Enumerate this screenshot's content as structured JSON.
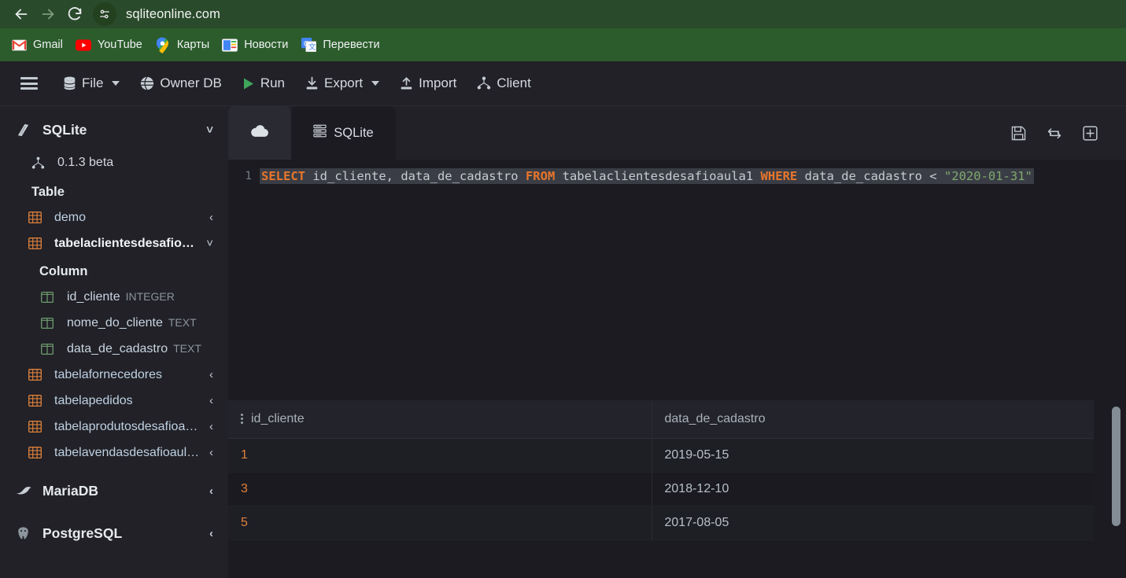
{
  "browser": {
    "back_icon": "back-arrow-icon",
    "forward_icon": "forward-arrow-icon",
    "reload_icon": "reload-icon",
    "site_info_icon": "site-settings-icon",
    "url": "sqliteonline.com",
    "toolbar_bg": "#2A4B2B",
    "bookmarks_bg": "#2C5C2C",
    "bookmarks": [
      {
        "label": "Gmail",
        "icon": "gmail-icon"
      },
      {
        "label": "YouTube",
        "icon": "youtube-icon"
      },
      {
        "label": "Карты",
        "icon": "google-maps-icon"
      },
      {
        "label": "Новости",
        "icon": "google-news-icon"
      },
      {
        "label": "Перевести",
        "icon": "google-translate-icon"
      }
    ]
  },
  "app_toolbar": {
    "menu_icon": "hamburger-menu-icon",
    "items": [
      {
        "label": "File",
        "icon": "database-stack-icon",
        "has_caret": true
      },
      {
        "label": "Owner DB",
        "icon": "globe-icon",
        "has_caret": false
      },
      {
        "label": "Run",
        "icon": "play-icon",
        "has_caret": false
      },
      {
        "label": "Export",
        "icon": "download-icon",
        "has_caret": true
      },
      {
        "label": "Import",
        "icon": "upload-icon",
        "has_caret": false
      },
      {
        "label": "Client",
        "icon": "network-nodes-icon",
        "has_caret": false
      }
    ],
    "run_color": "#3FA65B"
  },
  "sidebar": {
    "engines": [
      {
        "label": "SQLite",
        "icon": "sqlite-icon",
        "chevron": "chevron-down",
        "expanded": true
      },
      {
        "label": "MariaDB",
        "icon": "mariadb-icon",
        "chevron": "chevron-left",
        "expanded": false
      },
      {
        "label": "PostgreSQL",
        "icon": "postgresql-icon",
        "chevron": "chevron-left",
        "expanded": false
      }
    ],
    "version": {
      "label": "0.1.3 beta",
      "icon": "network-nodes-icon"
    },
    "table_section_label": "Table",
    "column_section_label": "Column",
    "tables": [
      {
        "label": "demo",
        "icon": "table-icon",
        "chevron": "chevron-left",
        "selected": false
      },
      {
        "label": "tabelaclientesdesafio…",
        "icon": "table-icon",
        "chevron": "chevron-down",
        "selected": true
      },
      {
        "label": "tabelafornecedores",
        "icon": "table-icon",
        "chevron": "chevron-left",
        "selected": false
      },
      {
        "label": "tabelapedidos",
        "icon": "table-icon",
        "chevron": "chevron-left",
        "selected": false
      },
      {
        "label": "tabelaprodutosdesafioa…",
        "icon": "table-icon",
        "chevron": "chevron-left",
        "selected": false
      },
      {
        "label": "tabelavendasdesafioaul…",
        "icon": "table-icon",
        "chevron": "chevron-left",
        "selected": false
      }
    ],
    "columns": [
      {
        "name": "id_cliente",
        "type": "INTEGER",
        "icon": "column-icon"
      },
      {
        "name": "nome_do_cliente",
        "type": "TEXT",
        "icon": "column-icon"
      },
      {
        "name": "data_de_cadastro",
        "type": "TEXT",
        "icon": "column-icon"
      }
    ],
    "table_icon_color": "#E0823C",
    "column_icon_color": "#6E9B6E"
  },
  "tabs": {
    "cloud_tab": {
      "label": "",
      "icon": "cloud-icon",
      "active": false
    },
    "sqlite_tab": {
      "label": "SQLite",
      "icon": "database-server-icon",
      "active": true
    }
  },
  "editor_actions": [
    {
      "icon": "save-floppy-icon",
      "name": "save-button"
    },
    {
      "icon": "sync-arrows-icon",
      "name": "sync-button"
    },
    {
      "icon": "plus-square-icon",
      "name": "add-tab-button"
    }
  ],
  "editor": {
    "line_number": "1",
    "query": "SELECT id_cliente, data_de_cadastro FROM tabelaclientesdesafioaula1 WHERE data_de_cadastro < \"2020-01-31\"",
    "tokens": [
      {
        "t": "SELECT",
        "k": "kw"
      },
      {
        "t": " id_cliente, data_de_cadastro ",
        "k": "op"
      },
      {
        "t": "FROM",
        "k": "kw"
      },
      {
        "t": " tabelaclientesdesafioaula1 ",
        "k": "op"
      },
      {
        "t": "WHERE",
        "k": "kw"
      },
      {
        "t": " data_de_cadastro < ",
        "k": "op"
      },
      {
        "t": "\"2020-01-31\"",
        "k": "str"
      }
    ],
    "keyword_color": "#E8762C",
    "string_color": "#7FA86F"
  },
  "results": {
    "columns": [
      "id_cliente",
      "data_de_cadastro"
    ],
    "rows": [
      {
        "id_cliente": "1",
        "data_de_cadastro": "2019-05-15"
      },
      {
        "id_cliente": "3",
        "data_de_cadastro": "2018-12-10"
      },
      {
        "id_cliente": "5",
        "data_de_cadastro": "2017-08-05"
      }
    ]
  }
}
